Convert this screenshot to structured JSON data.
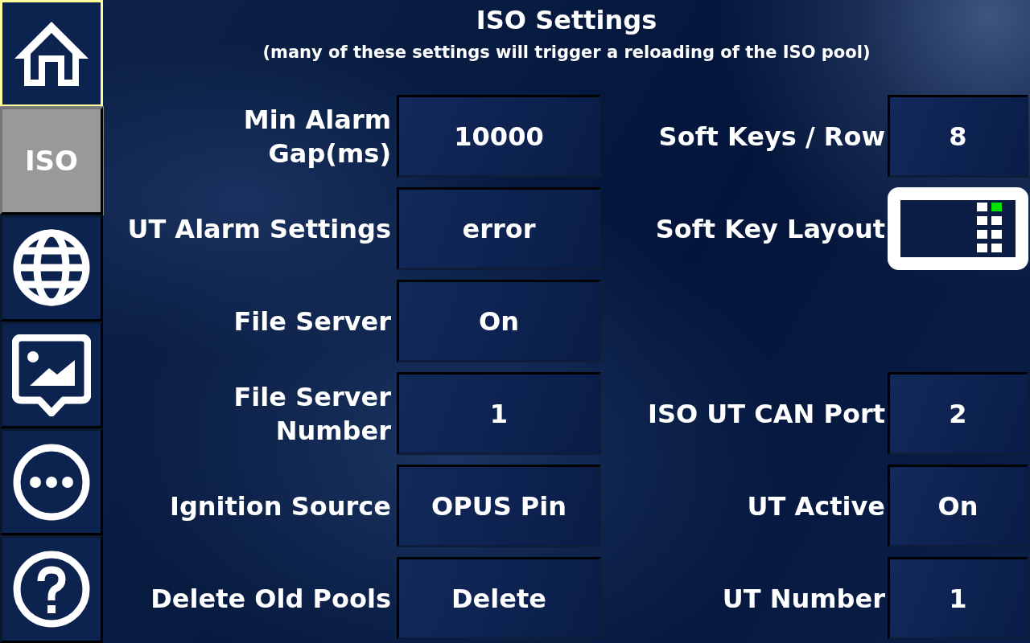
{
  "sidebar": {
    "items": [
      {
        "kind": "home",
        "selected": false,
        "focused": true
      },
      {
        "kind": "text",
        "label": "ISO",
        "selected": true,
        "focused": false
      },
      {
        "kind": "globe",
        "selected": false,
        "focused": false
      },
      {
        "kind": "image",
        "selected": false,
        "focused": false
      },
      {
        "kind": "more",
        "selected": false,
        "focused": false
      },
      {
        "kind": "help",
        "selected": false,
        "focused": false
      }
    ]
  },
  "header": {
    "title": "ISO Settings",
    "subtitle": "(many of these settings will trigger a reloading of the ISO pool)"
  },
  "rows": [
    {
      "left": {
        "label": "Min Alarm Gap(ms)",
        "kind": "value",
        "value": "10000"
      },
      "right": {
        "label": "Soft Keys / Row",
        "kind": "value",
        "value": "8"
      }
    },
    {
      "left": {
        "label": "UT Alarm Settings",
        "kind": "value",
        "value": "error"
      },
      "right": {
        "label": "Soft Key Layout",
        "kind": "layout"
      }
    },
    {
      "left": {
        "label": "File Server",
        "kind": "value",
        "value": "On"
      }
    },
    {
      "left": {
        "label": "File Server Number",
        "kind": "value",
        "value": "1"
      },
      "right": {
        "label": "ISO UT CAN Port",
        "kind": "value",
        "value": "2"
      }
    },
    {
      "left": {
        "label": "Ignition Source",
        "kind": "value",
        "value": "OPUS Pin"
      },
      "right": {
        "label": "UT Active",
        "kind": "value",
        "value": "On"
      }
    },
    {
      "left": {
        "label": "Delete Old Pools",
        "kind": "value",
        "value": "Delete"
      },
      "right": {
        "label": "UT Number",
        "kind": "value",
        "value": "1"
      }
    }
  ]
}
